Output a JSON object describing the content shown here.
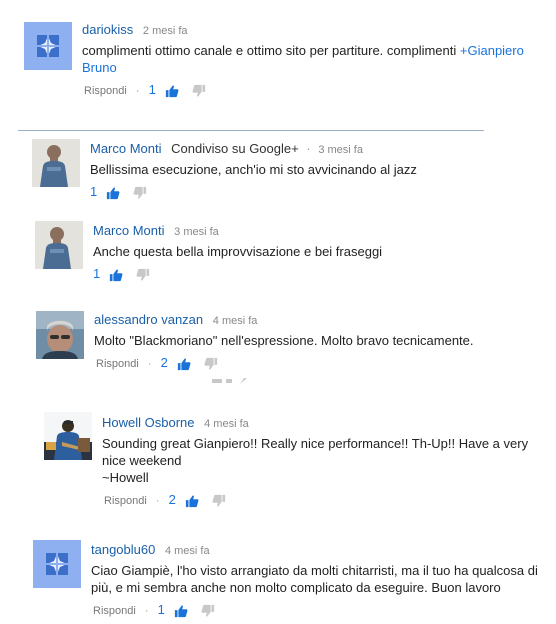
{
  "comments": [
    {
      "author": "dariokiss",
      "time": "2 mesi fa",
      "text": "complimenti ottimo canale e ottimo sito per partiture. complimenti ",
      "mention": "+Gianpiero Bruno",
      "reply_label": "Rispondi",
      "likes": "1"
    },
    {
      "author": "Marco Monti",
      "shared": "Condiviso su Google+",
      "time": "3 mesi fa",
      "text": "Bellissima esecuzione, anch'io mi sto avvicinando al jazz",
      "likes": "1"
    },
    {
      "author": "Marco Monti",
      "time": "3 mesi fa",
      "text": "Anche questa bella improvvisazione e bei fraseggi",
      "likes": "1"
    },
    {
      "author": "alessandro vanzan",
      "time": "4 mesi fa",
      "text": "Molto \"Blackmoriano\" nell'espressione. Molto bravo tecnicamente.",
      "reply_label": "Rispondi",
      "likes": "2"
    },
    {
      "author": "Howell Osborne",
      "time": "4 mesi fa",
      "text_lines": [
        "Sounding great Gianpiero!! Really nice performance!! Th-Up!! Have a very nice weekend",
        "~Howell"
      ],
      "reply_label": "Rispondi",
      "likes": "2"
    },
    {
      "author": "tangoblu60",
      "time": "4 mesi fa",
      "text": "Ciao Giampiè, l'ho visto arrangiato da molti chitarristi, ma il tuo ha qualcosa di più, e mi sembra anche non molto complicato da eseguire. Buon lavoro",
      "reply_label": "Rispondi",
      "likes": "1"
    }
  ],
  "colors": {
    "author_link": "#1a5fa8",
    "count_blue": "#1a73d9",
    "default_avatar_bg": "#8fb0f0",
    "divider": "#9ab0c7"
  },
  "icons": {
    "like": "thumb-up-icon",
    "dislike": "thumb-down-icon",
    "separator": "middle-dot"
  }
}
